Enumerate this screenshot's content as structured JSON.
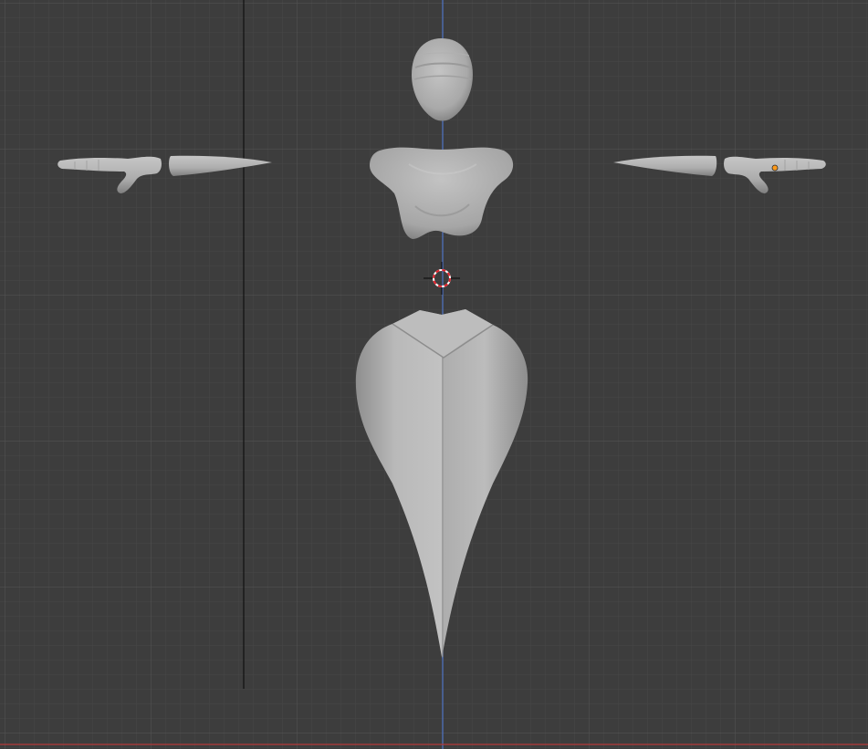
{
  "viewport": {
    "view": "front-orthographic",
    "background_color": "#3d3d3d",
    "grid_minor_color": "#474747",
    "grid_major_color": "#555555",
    "axis_z_color": "#4f74c6",
    "axis_x_color": "#b43a3a",
    "mesh_color": "#b7b7b7",
    "mesh_shadow_color": "#7d7d7d",
    "selected_vertex_color": "#ff9a1a",
    "cursor_ring_red": "#e2202b",
    "cursor_ring_white": "#ffffff"
  },
  "scene": {
    "objects": [
      {
        "id": "head",
        "type": "mesh"
      },
      {
        "id": "chest",
        "type": "mesh"
      },
      {
        "id": "hips",
        "type": "mesh"
      },
      {
        "id": "left-upper-arm",
        "type": "mesh"
      },
      {
        "id": "left-hand",
        "type": "mesh"
      },
      {
        "id": "right-upper-arm",
        "type": "mesh"
      },
      {
        "id": "right-hand",
        "type": "mesh"
      }
    ]
  }
}
